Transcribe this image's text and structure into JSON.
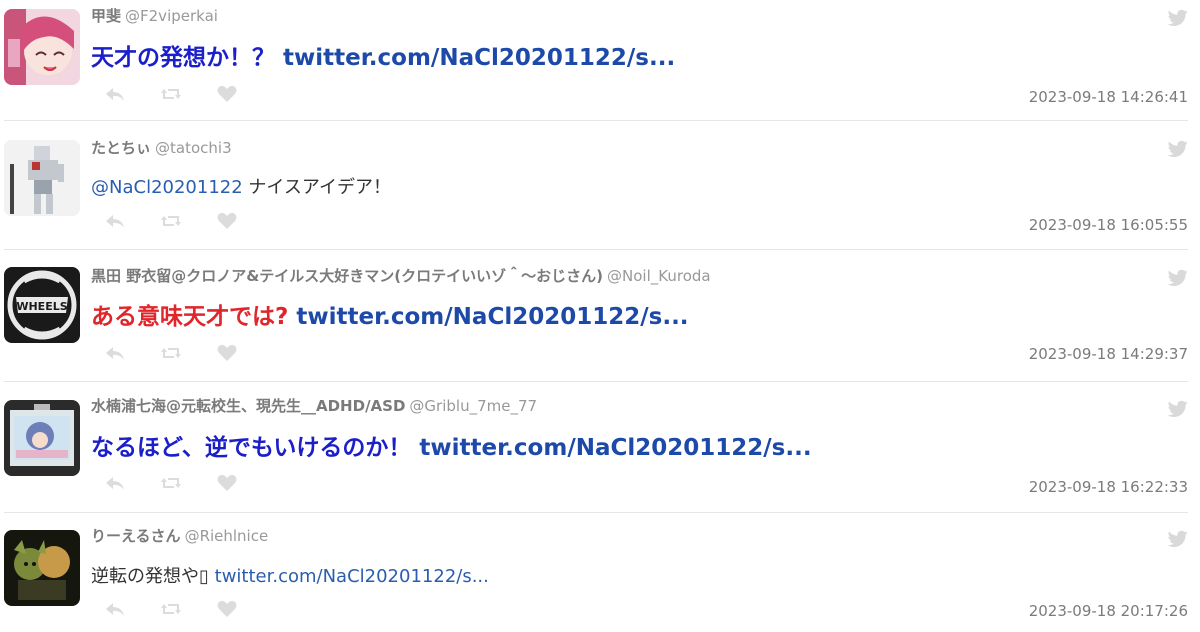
{
  "tweets": [
    {
      "display_name": "甲斐",
      "handle": "@F2viperkai",
      "text": "天才の発想か！？",
      "link": "twitter.com/NaCl20201122/s...",
      "timestamp": "2023-09-18 14:26:41"
    },
    {
      "display_name": "たとちぃ",
      "handle": "@tatochi3",
      "mention": "@NaCl20201122",
      "text": "ナイスアイデア！",
      "timestamp": "2023-09-18 16:05:55"
    },
    {
      "display_name": "黒田 野衣留@クロノア&テイルス大好きマン(クロテイいいゾ＾～おじさん)",
      "handle": "@Noil_Kuroda",
      "text": "ある意味天才では?",
      "link": "twitter.com/NaCl20201122/s...",
      "timestamp": "2023-09-18 14:29:37"
    },
    {
      "display_name": "水楠浦七海@元転校生、現先生__ADHD/ASD",
      "handle": "@Griblu_7me_77",
      "text": "なるほど、逆でもいけるのか！",
      "link": "twitter.com/NaCl20201122/s...",
      "timestamp": "2023-09-18 16:22:33"
    },
    {
      "display_name": "りーえるさん",
      "handle": "@Riehlnice",
      "text": "逆転の発想や▯",
      "link": "twitter.com/NaCl20201122/s...",
      "timestamp": "2023-09-18 20:17:26"
    }
  ],
  "icons": {
    "reply": "reply-icon",
    "retweet": "retweet-icon",
    "like": "heart-icon",
    "source": "twitter-bird-icon"
  },
  "colors": {
    "accent_blue": "#1b1fc9",
    "accent_red": "#e0262b",
    "link": "#1d49a8",
    "meta_gray": "#7b7b7b",
    "icon_gray": "#d9d9d9"
  }
}
